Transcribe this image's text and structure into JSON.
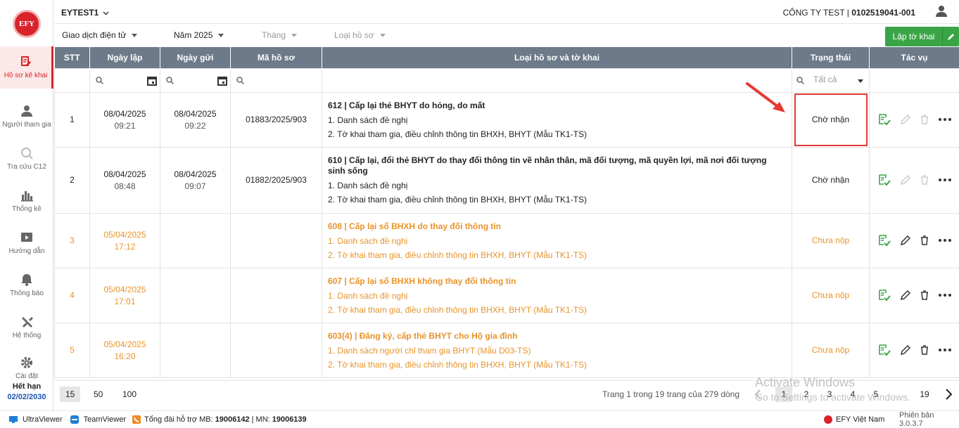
{
  "brand": {
    "logo": "EFY"
  },
  "sidebar": {
    "items": [
      {
        "label": "Hồ sơ kê khai",
        "icon": "document-edit-icon"
      },
      {
        "label": "Người tham gia",
        "icon": "person-icon"
      },
      {
        "label": "Tra cứu C12",
        "icon": "search-c12-icon"
      },
      {
        "label": "Thống kê",
        "icon": "bar-chart-icon"
      },
      {
        "label": "Hướng dẫn",
        "icon": "guide-icon"
      },
      {
        "label": "Thông báo",
        "icon": "bell-icon"
      },
      {
        "label": "Hệ thống",
        "icon": "tools-icon"
      },
      {
        "label": "Cài đặt",
        "icon": "gear-icon"
      }
    ],
    "expire_label": "Hết hạn",
    "expire_date": "02/02/2030"
  },
  "header": {
    "account": "EYTEST1",
    "company": "CÔNG TY TEST |",
    "tax_code": "0102519041-001"
  },
  "filters": {
    "type": "Giao dịch điện tử",
    "year": "Năm 2025",
    "month": "Tháng",
    "doc_type": "Loại hồ sơ",
    "create_button": "Lập tờ khai"
  },
  "table": {
    "headers": {
      "stt": "STT",
      "created": "Ngày lập",
      "sent": "Ngày gửi",
      "code": "Mã hồ sơ",
      "desc": "Loại hồ sơ và tờ khai",
      "status": "Trạng thái",
      "actions": "Tác vụ"
    },
    "status_filter": "Tất cả",
    "rows": [
      {
        "stt": "1",
        "created_date": "08/04/2025",
        "created_time": "09:21",
        "sent_date": "08/04/2025",
        "sent_time": "09:22",
        "code": "01883/2025/903",
        "title": "612 | Cấp lại thẻ BHYT do hỏng, do mất",
        "lines": [
          "1. Danh sách đề nghị",
          "2. Tờ khai tham gia, điều chỉnh thông tin BHXH, BHYT (Mẫu TK1-TS)"
        ],
        "status": "Chờ nhận"
      },
      {
        "stt": "2",
        "created_date": "08/04/2025",
        "created_time": "08:48",
        "sent_date": "08/04/2025",
        "sent_time": "09:07",
        "code": "01882/2025/903",
        "title": "610 | Cấp lại, đổi thẻ BHYT do thay đổi thông tin về nhân thân, mã đối tượng, mã quyền lợi, mã nơi đối tượng sinh sống",
        "lines": [
          "1. Danh sách đề nghị",
          "2. Tờ khai tham gia, điều chỉnh thông tin BHXH, BHYT (Mẫu TK1-TS)"
        ],
        "status": "Chờ nhận"
      },
      {
        "stt": "3",
        "created_date": "05/04/2025",
        "created_time": "17:12",
        "sent_date": "",
        "sent_time": "",
        "code": "",
        "title": "608 | Cấp lại sổ BHXH do thay đổi thông tin",
        "lines": [
          "1. Danh sách đề nghị",
          "2. Tờ khai tham gia, điều chỉnh thông tin BHXH, BHYT (Mẫu TK1-TS)"
        ],
        "status": "Chưa nộp"
      },
      {
        "stt": "4",
        "created_date": "05/04/2025",
        "created_time": "17:01",
        "sent_date": "",
        "sent_time": "",
        "code": "",
        "title": "607 | Cấp lại sổ BHXH không thay đổi thông tin",
        "lines": [
          "1. Danh sách đề nghị",
          "2. Tờ khai tham gia, điều chỉnh thông tin BHXH, BHYT (Mẫu TK1-TS)"
        ],
        "status": "Chưa nộp"
      },
      {
        "stt": "5",
        "created_date": "05/04/2025",
        "created_time": "16:20",
        "sent_date": "",
        "sent_time": "",
        "code": "",
        "title": "603(4) | Đăng ký, cấp thẻ BHYT cho Hộ gia đình",
        "lines": [
          "1. Danh sách người chỉ tham gia BHYT (Mẫu D03-TS)",
          "2. Tờ khai tham gia, điều chỉnh thông tin BHXH, BHYT (Mẫu TK1-TS)"
        ],
        "status": "Chưa nộp"
      }
    ]
  },
  "pager": {
    "sizes": [
      "15",
      "50",
      "100"
    ],
    "info": "Trang 1 trong 19 trang của 279 dòng",
    "pages": [
      "1",
      "2",
      "3",
      "4",
      "5",
      "19"
    ]
  },
  "watermark": {
    "line1": "Activate Windows",
    "line2": "Go to Settings to activate Windows."
  },
  "footer": {
    "ultraviewer": "UltraViewer",
    "teamviewer": "TeamViewer",
    "support_prefix": "Tổng đài hỗ trợ MB:",
    "support_mb": "19006142",
    "support_sep": "| MN:",
    "support_mn": "19006139",
    "vendor": "EFY Việt Nam",
    "version": "Phiên bản 3.0.3.7"
  },
  "colors": {
    "accent": "#d9232a",
    "header_bg": "#6c7a89",
    "pending": "#e8932a",
    "create_button": "#3aa546"
  }
}
